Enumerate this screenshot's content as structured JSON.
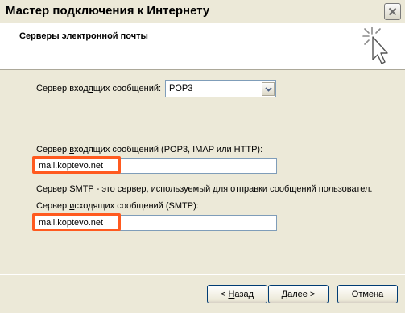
{
  "window": {
    "title": "Мастер подключения к Интернету",
    "close_icon": "close-icon"
  },
  "header": {
    "title": "Серверы электронной почты",
    "icon": "sparkle-cursor-icon"
  },
  "form": {
    "incoming_type_label_prefix": "Сервер вход",
    "incoming_type_label_accel": "я",
    "incoming_type_label_suffix": "щих сообщений:",
    "incoming_type_value": "POP3",
    "incoming_server_label_prefix": "Сервер ",
    "incoming_server_label_accel": "в",
    "incoming_server_label_suffix": "ходящих сообщений (POP3, IMAP или HTTP):",
    "incoming_server_value": "mail.koptevo.net",
    "smtp_description": "Сервер SMTP - это сервер, используемый для отправки сообщений  пользовател.",
    "outgoing_server_label_prefix": "Сервер ",
    "outgoing_server_label_accel": "и",
    "outgoing_server_label_suffix": "сходящих сообщений (SMTP):",
    "outgoing_server_value": "mail.koptevo.net",
    "highlight_color": "#ff5a1f"
  },
  "buttons": {
    "back_prefix": "< ",
    "back_accel": "Н",
    "back_suffix": "азад",
    "next_prefix": "",
    "next_accel": "Д",
    "next_suffix": "алее >",
    "cancel": "Отмена"
  }
}
